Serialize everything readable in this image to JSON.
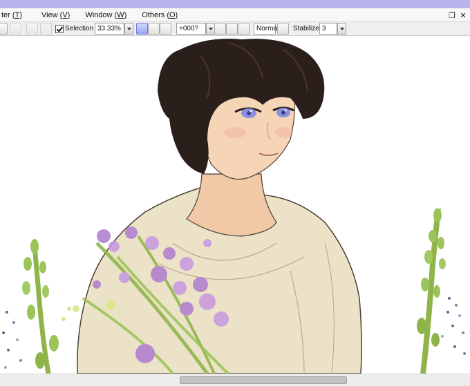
{
  "menubar": {
    "items": [
      {
        "text": "ter",
        "accel": "(T)"
      },
      {
        "text": "View",
        "accel": "(V)"
      },
      {
        "text": "Window",
        "accel": "(W)"
      },
      {
        "text": "Others",
        "accel": "(O)"
      }
    ]
  },
  "toolbar": {
    "selection_label": "Selection",
    "selection_checked": true,
    "zoom_value": "33.33%",
    "rotation_value": "+000?",
    "blend_mode": "Normal",
    "stabilizer_label": "Stabilizer",
    "stabilizer_value": "3"
  },
  "colors": {
    "titlebar": "#b9b3ee",
    "skin": "#f4d2b2",
    "hair": "#2b1f1c",
    "shirt": "#ebe2c7",
    "eyes": "#8c8fe0",
    "flower_purple": "#b07fd0",
    "stem_green": "#8fb54a"
  },
  "canvas": {
    "subject": "illustration of a young man with curly dark hair in a cream shirt holding purple flowers"
  }
}
